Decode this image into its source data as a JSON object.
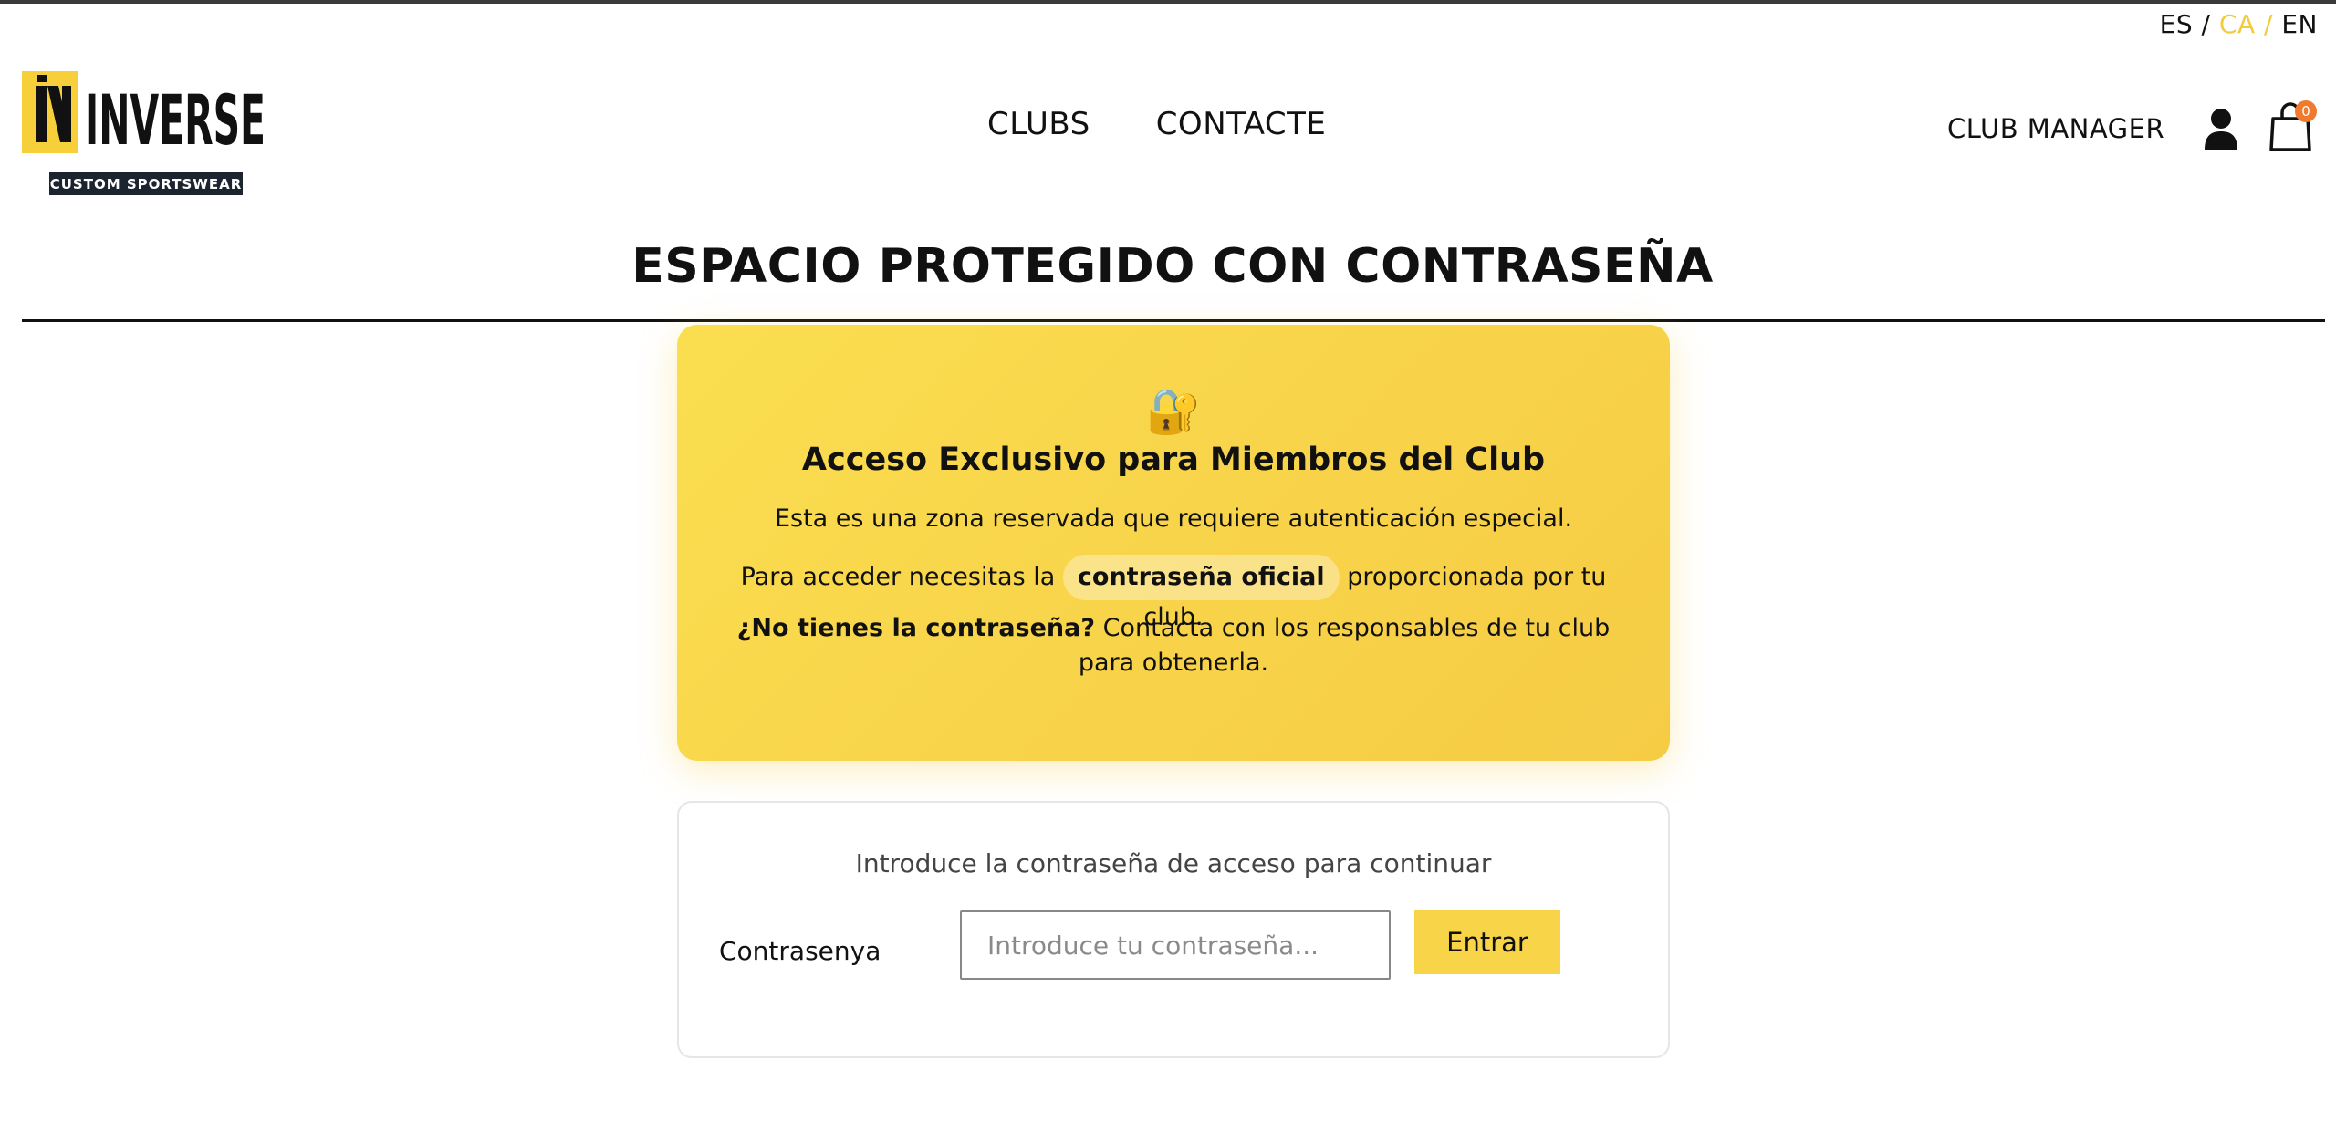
{
  "header": {
    "languages": [
      {
        "code": "ES",
        "active": false
      },
      {
        "code": "CA",
        "active": true
      },
      {
        "code": "EN",
        "active": false
      }
    ],
    "separator": "/",
    "logo": {
      "main": "INVERSE",
      "tagline": "CUSTOM SPORTSWEAR"
    },
    "nav": [
      "CLUBS",
      "CONTACTE"
    ],
    "club_manager": "CLUB MANAGER",
    "user_icon": "user-icon",
    "cart_icon": "shopping-bag-icon",
    "cart_count": "0",
    "accent": "#f2cc3d",
    "badge_color": "#f07a2d"
  },
  "page": {
    "title": "ESPACIO PROTEGIDO CON CONTRASEÑA"
  },
  "notice": {
    "icon": "🔐",
    "heading": "Acceso Exclusivo para Miembros del Club",
    "line1": "Esta es una zona reservada que requiere autenticación especial.",
    "line2_before": "Para acceder necesitas la",
    "line2_highlight": "contraseña oficial",
    "line2_after": "proporcionada por tu club.",
    "line3_bold": "¿No tienes la contraseña?",
    "line3_rest": "Contacta con los responsables de tu club para obtenerla.",
    "background": "#f8d44a"
  },
  "login": {
    "hint": "Introduce la contraseña de acceso para continuar",
    "label": "Contrasenya",
    "placeholder": "Introduce tu contraseña...",
    "value": "",
    "button": "Entrar",
    "button_color": "#f8d548"
  }
}
